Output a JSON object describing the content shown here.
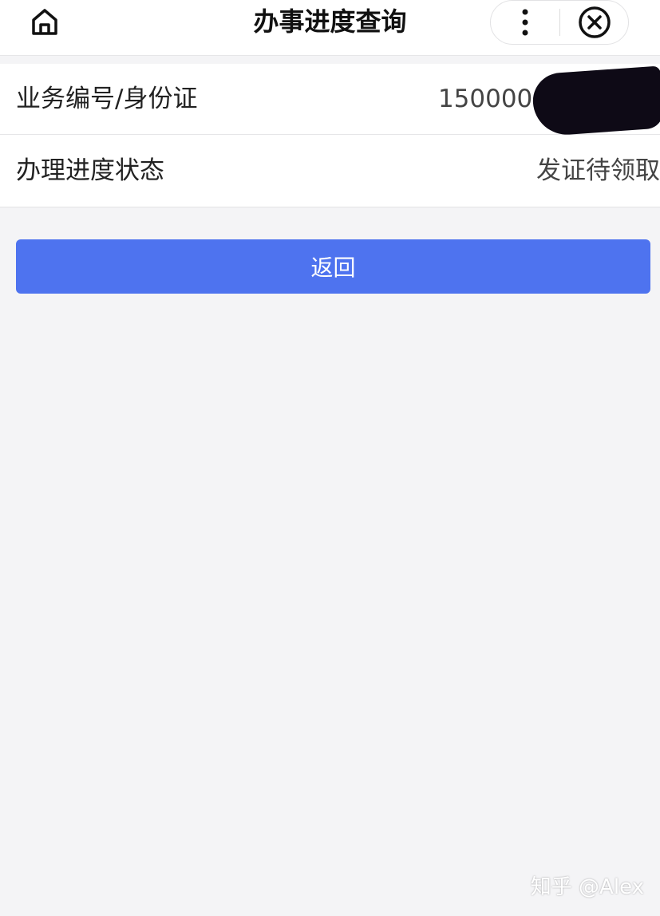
{
  "header": {
    "title": "办事进度查询",
    "home_icon": "home-icon",
    "more_icon": "more-vertical-icon",
    "close_icon": "close-circle-icon"
  },
  "details": {
    "rows": [
      {
        "label": "业务编号/身份证",
        "value": "1500000"
      },
      {
        "label": "办理进度状态",
        "value": "发证待领取"
      }
    ]
  },
  "actions": {
    "back_label": "返回"
  },
  "watermark": {
    "text": "知乎 @Alex"
  },
  "colors": {
    "primary_button": "#4e73ef",
    "background": "#f4f4f6",
    "card": "#ffffff"
  }
}
